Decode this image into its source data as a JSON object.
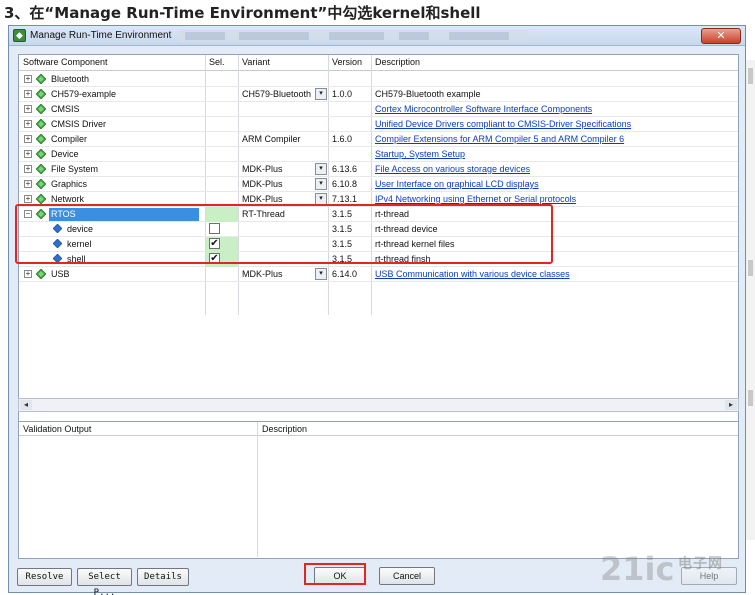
{
  "page_heading": "3、在“Manage Run-Time Environment”中勾选kernel和shell",
  "window": {
    "title": "Manage Run-Time Environment",
    "close_glyph": "✕"
  },
  "columns": {
    "component": "Software Component",
    "sel": "Sel.",
    "variant": "Variant",
    "version": "Version",
    "description": "Description"
  },
  "rows": [
    {
      "name": "Bluetooth",
      "expander": "+",
      "variant": "",
      "version": "",
      "description": "",
      "link": false
    },
    {
      "name": "CH579-example",
      "expander": "+",
      "variant": "CH579-Bluetooth",
      "version": "1.0.0",
      "description": "CH579-Bluetooth example",
      "link": false
    },
    {
      "name": "CMSIS",
      "expander": "+",
      "variant": "",
      "version": "",
      "description": "Cortex Microcontroller Software Interface Components",
      "link": true
    },
    {
      "name": "CMSIS Driver",
      "expander": "+",
      "variant": "",
      "version": "",
      "description": "Unified Device Drivers compliant to CMSIS-Driver Specifications",
      "link": true
    },
    {
      "name": "Compiler",
      "expander": "+",
      "variant": "ARM Compiler",
      "version": "1.6.0",
      "description": "Compiler Extensions for ARM Compiler 5 and ARM Compiler 6",
      "link": true
    },
    {
      "name": "Device",
      "expander": "+",
      "variant": "",
      "version": "",
      "description": "Startup, System Setup",
      "link": true
    },
    {
      "name": "File System",
      "expander": "+",
      "variant": "MDK-Plus",
      "version": "6.13.6",
      "description": "File Access on various storage devices",
      "link": true
    },
    {
      "name": "Graphics",
      "expander": "+",
      "variant": "MDK-Plus",
      "version": "6.10.8",
      "description": "User Interface on graphical LCD displays",
      "link": true
    },
    {
      "name": "Network",
      "expander": "+",
      "variant": "MDK-Plus",
      "version": "7.13.1",
      "description": "IPv4 Networking using Ethernet or Serial protocols",
      "link": true
    },
    {
      "name": "RTOS",
      "expander": "−",
      "variant": "RT-Thread",
      "version": "3.1.5",
      "description": "rt-thread",
      "link": false
    },
    {
      "name": "device",
      "expander": "",
      "variant": "",
      "version": "3.1.5",
      "description": "rt-thread device",
      "link": false,
      "checked": false
    },
    {
      "name": "kernel",
      "expander": "",
      "variant": "",
      "version": "3.1.5",
      "description": "rt-thread kernel files",
      "link": false,
      "checked": true
    },
    {
      "name": "shell",
      "expander": "",
      "variant": "",
      "version": "3.1.5",
      "description": "rt-thread finsh",
      "link": false,
      "checked": true
    },
    {
      "name": "USB",
      "expander": "+",
      "variant": "MDK-Plus",
      "version": "6.14.0",
      "description": "USB Communication with various device classes",
      "link": true
    }
  ],
  "check_glyph": "✔",
  "dropdown_glyph": "▾",
  "lower": {
    "validation_output": "Validation Output",
    "description": "Description"
  },
  "buttons": {
    "resolve": "Resolve",
    "select_packs": "Select P...",
    "details": "Details",
    "ok": "OK",
    "cancel": "Cancel",
    "help": "Help"
  },
  "scroll": {
    "left": "◂",
    "right": "▸"
  },
  "watermark": {
    "text": "21ic",
    "sub": "电子网"
  },
  "colors": {
    "accent": "#3c8fe0",
    "highlight_red": "#e3261e",
    "selected_green": "#c8f0c4",
    "link": "#0b3bcc"
  }
}
